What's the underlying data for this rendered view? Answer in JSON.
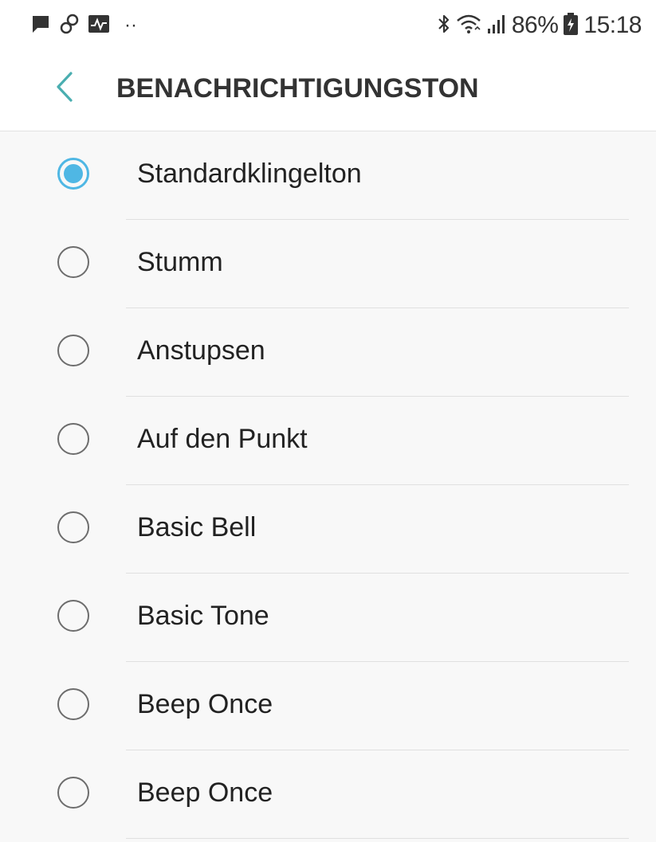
{
  "status_bar": {
    "icons_left": [
      "message-icon",
      "link-icon",
      "activity-icon",
      "more-dots-icon"
    ],
    "dots": "··",
    "icons_right": [
      "bluetooth-icon",
      "wifi-icon",
      "signal-icon",
      "battery-icon"
    ],
    "battery": "86%",
    "time": "15:18"
  },
  "app_bar": {
    "title": "BENACHRICHTIGUNGSTON",
    "back_icon": "chevron-left-icon"
  },
  "colors": {
    "accent": "#4fb7e4",
    "background": "#f8f8f8",
    "radio_off": "#6d6d6d",
    "text": "#222222"
  },
  "list": {
    "selected_index": 0,
    "items": [
      {
        "label": "Standardklingelton",
        "checked": true
      },
      {
        "label": "Stumm",
        "checked": false
      },
      {
        "label": "Anstupsen",
        "checked": false
      },
      {
        "label": "Auf den Punkt",
        "checked": false
      },
      {
        "label": "Basic Bell",
        "checked": false
      },
      {
        "label": "Basic Tone",
        "checked": false
      },
      {
        "label": "Beep Once",
        "checked": false
      },
      {
        "label": "Beep Once",
        "checked": false
      }
    ]
  }
}
